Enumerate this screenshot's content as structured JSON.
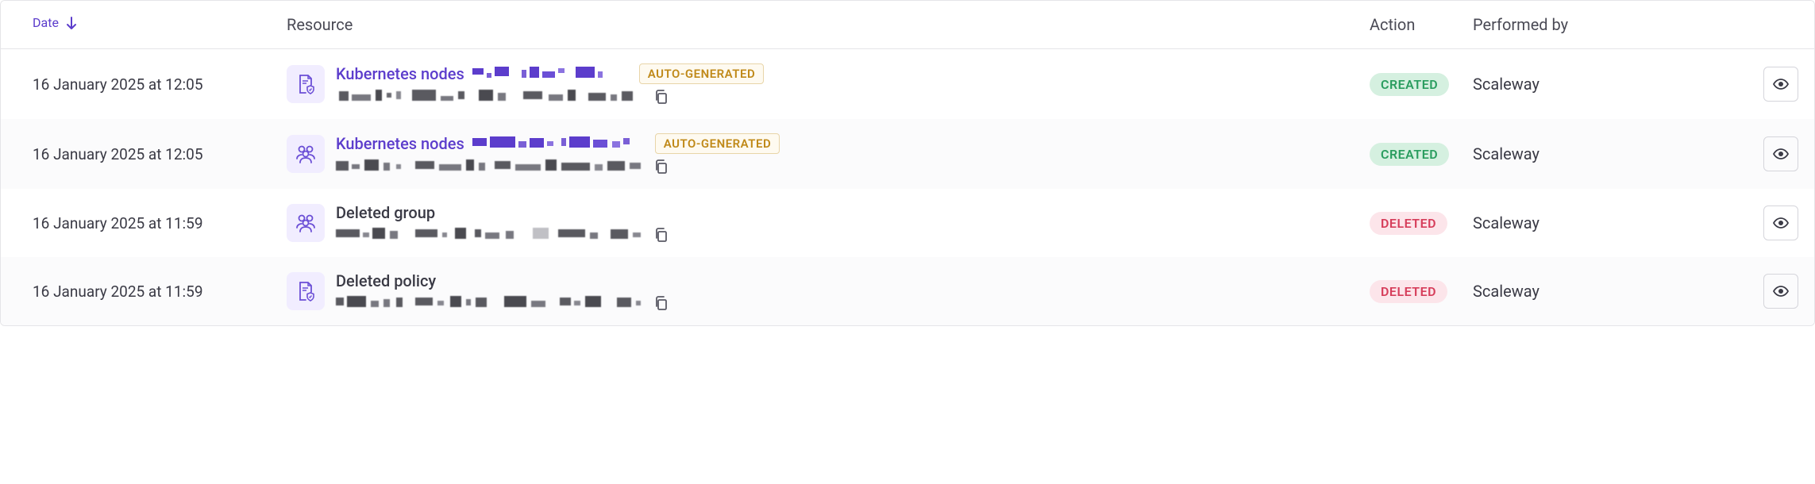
{
  "columns": {
    "date": "Date",
    "resource": "Resource",
    "action": "Action",
    "performed_by": "Performed by"
  },
  "badges": {
    "auto_generated": "AUTO-GENERATED"
  },
  "actions": {
    "created": "CREATED",
    "deleted": "DELETED"
  },
  "rows": [
    {
      "date": "16 January 2025 at 12:05",
      "resource_title": "Kubernetes nodes",
      "resource_type": "policy",
      "has_badge": true,
      "title_link": true,
      "action": "created",
      "performed_by": "Scaleway"
    },
    {
      "date": "16 January 2025 at 12:05",
      "resource_title": "Kubernetes nodes",
      "resource_type": "group",
      "has_badge": true,
      "title_link": true,
      "action": "created",
      "performed_by": "Scaleway"
    },
    {
      "date": "16 January 2025 at 11:59",
      "resource_title": "Deleted group",
      "resource_type": "group",
      "has_badge": false,
      "title_link": false,
      "action": "deleted",
      "performed_by": "Scaleway"
    },
    {
      "date": "16 January 2025 at 11:59",
      "resource_title": "Deleted policy",
      "resource_type": "policy",
      "has_badge": false,
      "title_link": false,
      "action": "deleted",
      "performed_by": "Scaleway"
    }
  ]
}
